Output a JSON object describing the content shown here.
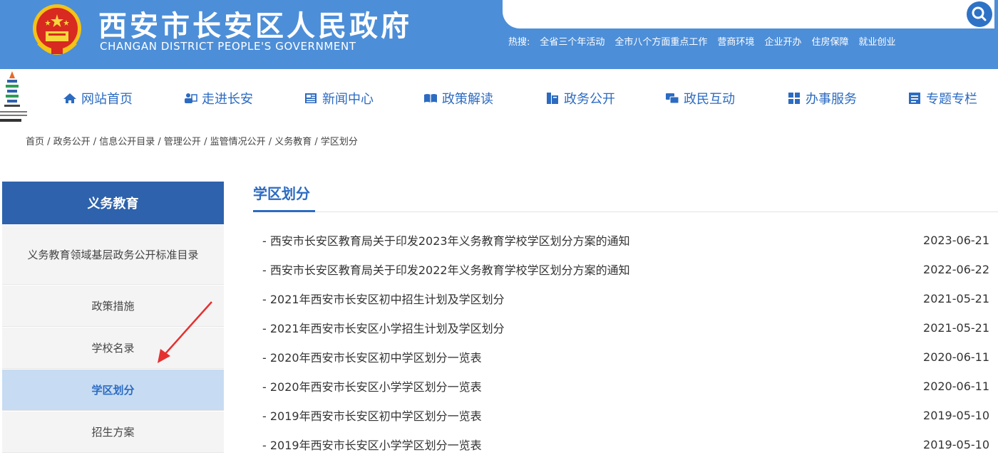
{
  "header": {
    "title": "西安市长安区人民政府",
    "subtitle": "CHANGAN DISTRICT PEOPLE'S GOVERNMENT",
    "search_placeholder": "",
    "hot_label": "热搜:",
    "hot_links": [
      "全省三个年活动",
      "全市八个方面重点工作",
      "营商环境",
      "企业开办",
      "住房保障",
      "就业创业"
    ]
  },
  "nav": {
    "items": [
      {
        "label": "网站首页",
        "icon": "home-icon"
      },
      {
        "label": "走进长安",
        "icon": "about-icon"
      },
      {
        "label": "新闻中心",
        "icon": "news-icon"
      },
      {
        "label": "政策解读",
        "icon": "policy-icon"
      },
      {
        "label": "政务公开",
        "icon": "open-icon"
      },
      {
        "label": "政民互动",
        "icon": "interaction-icon"
      },
      {
        "label": "办事服务",
        "icon": "service-icon"
      },
      {
        "label": "专题专栏",
        "icon": "topic-icon"
      }
    ]
  },
  "breadcrumb": "首页 / 政务公开 / 信息公开目录 / 管理公开 / 监管情况公开 / 义务教育 / 学区划分",
  "sidebar": {
    "title": "义务教育",
    "items": [
      {
        "label": "义务教育领域基层政务公开标准目录",
        "active": false
      },
      {
        "label": "政策措施",
        "active": false
      },
      {
        "label": "学校名录",
        "active": false
      },
      {
        "label": "学区划分",
        "active": true
      },
      {
        "label": "招生方案",
        "active": false
      }
    ]
  },
  "main": {
    "title": "学区划分",
    "items": [
      {
        "title": "西安市长安区教育局关于印发2023年义务教育学校学区划分方案的通知",
        "date": "2023-06-21"
      },
      {
        "title": "西安市长安区教育局关于印发2022年义务教育学校学区划分方案的通知",
        "date": "2022-06-22"
      },
      {
        "title": "2021年西安市长安区初中招生计划及学区划分",
        "date": "2021-05-21"
      },
      {
        "title": "2021年西安市长安区小学招生计划及学区划分",
        "date": "2021-05-21"
      },
      {
        "title": "2020年西安市长安区初中学区划分一览表",
        "date": "2020-06-11"
      },
      {
        "title": "2020年西安市长安区小学学区划分一览表",
        "date": "2020-06-11"
      },
      {
        "title": "2019年西安市长安区初中学区划分一览表",
        "date": "2019-05-10"
      },
      {
        "title": "2019年西安市长安区小学学区划分一览表",
        "date": "2019-05-10"
      }
    ]
  },
  "colors": {
    "header_bg": "#4d8ed8",
    "accent": "#2c6bc2",
    "sidebar_title_bg": "#2e62ac",
    "sidebar_active_bg": "#c7dcf2",
    "annotation_arrow": "#e53030"
  }
}
